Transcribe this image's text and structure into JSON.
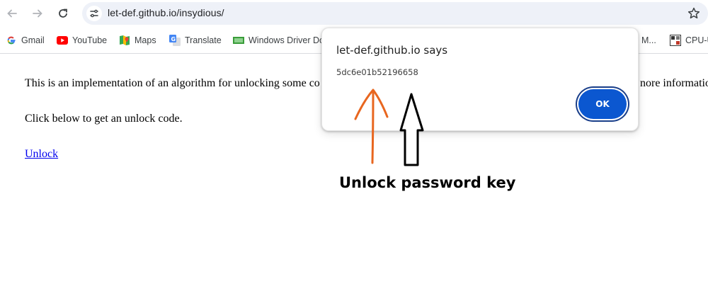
{
  "browser": {
    "url": "let-def.github.io/insydious/"
  },
  "bookmarks": [
    {
      "label": "Gmail"
    },
    {
      "label": "YouTube"
    },
    {
      "label": "Maps"
    },
    {
      "label": "Translate"
    },
    {
      "label": "Windows Driver Do"
    },
    {
      "label": "M..."
    },
    {
      "label": "CPU-U"
    }
  ],
  "page": {
    "intro_visible": "This is an implementation of an algorithm for unlocking some co",
    "intro_tail": "nore information",
    "instruction": "Click below to get an unlock code.",
    "unlock_link": "Unlock"
  },
  "dialog": {
    "title": "let-def.github.io says",
    "message": "5dc6e01b52196658",
    "ok_label": "OK"
  },
  "annotation": {
    "label": "Unlock password key",
    "orange_arrow_color": "#e8661f",
    "black_arrow_color": "#000000"
  },
  "colors": {
    "accent": "#0b57d0",
    "omnibox_bg": "#eef1f8",
    "link": "#0000ee"
  }
}
